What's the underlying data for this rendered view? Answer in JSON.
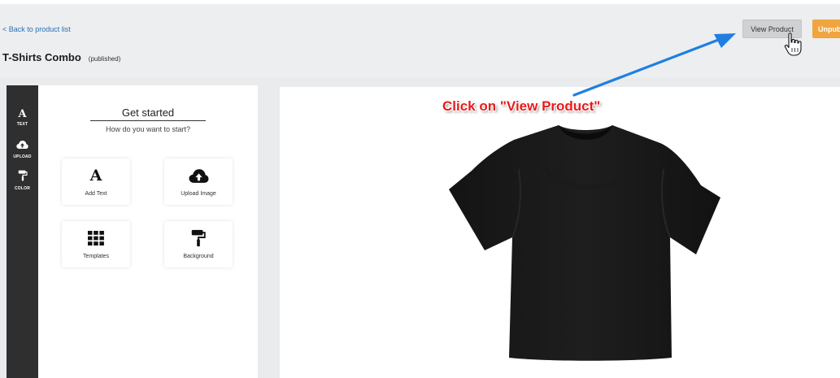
{
  "header": {
    "back_link": "< Back to product list",
    "title": "T-Shirts Combo",
    "status": "(published)",
    "view_button": "View Product",
    "unpublish_button": "Unpub"
  },
  "tools": [
    {
      "label": "TEXT",
      "icon": "letter-a-icon"
    },
    {
      "label": "UPLOAD",
      "icon": "cloud-upload-icon"
    },
    {
      "label": "COLOR",
      "icon": "paint-roller-icon"
    }
  ],
  "panel": {
    "title": "Get started",
    "subtitle": "How do you want to start?",
    "options": [
      {
        "label": "Add Text",
        "icon": "letter-a-icon"
      },
      {
        "label": "Upload Image",
        "icon": "cloud-upload-icon"
      },
      {
        "label": "Templates",
        "icon": "grid-icon"
      },
      {
        "label": "Background",
        "icon": "paint-roller-icon"
      }
    ]
  },
  "annotation": {
    "callout": "Click on \"View Product\"",
    "color": "#e81a1a",
    "arrow_color": "#1f7fe0"
  },
  "colors": {
    "accent_orange": "#f0a540",
    "link_blue": "#2a6fb5",
    "tool_rail": "#2f2f2f"
  }
}
